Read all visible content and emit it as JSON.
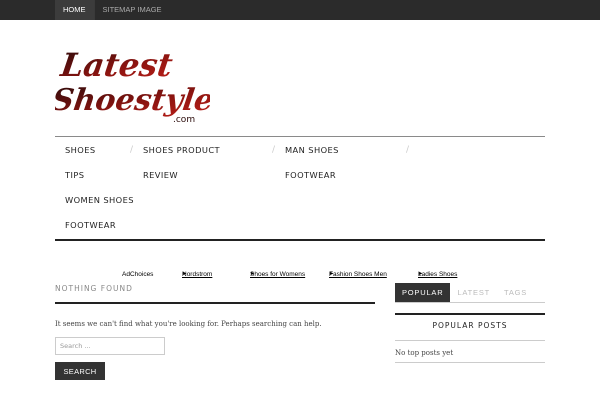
{
  "topnav": {
    "home": "HOME",
    "sitemap": "SITEMAP IMAGE"
  },
  "logo": {
    "line1": "Latest",
    "line2": "Shoestyle",
    "suffix": ".com",
    "colors": {
      "dark": "#2a0a0a",
      "red": "#c0201a"
    }
  },
  "mainnav": {
    "items": [
      "SHOES",
      "SHOES PRODUCT",
      "MAN SHOES",
      "TIPS",
      "REVIEW",
      "FOOTWEAR",
      "WOMEN SHOES",
      "FOOTWEAR"
    ],
    "separator": "/"
  },
  "ads": {
    "label": "AdChoices",
    "links": [
      "Nordstrom",
      "Shoes for Womens",
      "Fashion Shoes Men",
      "Ladies Shoes"
    ]
  },
  "content": {
    "title": "NOTHING FOUND",
    "message": "It seems we can't find what you're looking for. Perhaps searching can help.",
    "search_placeholder": "Search ...",
    "search_button": "SEARCH"
  },
  "sidebar": {
    "tabs": [
      "POPULAR",
      "LATEST",
      "TAGS"
    ],
    "popular_title": "POPULAR POSTS",
    "empty": "No top posts yet"
  }
}
